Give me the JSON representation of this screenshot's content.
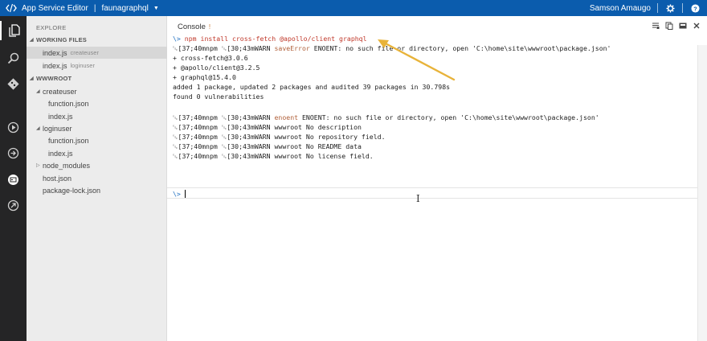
{
  "topbar": {
    "app_title": "App Service Editor",
    "separator": "|",
    "site_name": "faunagraphql",
    "user_name": "Samson Amaugo",
    "accent_color": "#0b5cad",
    "icons": [
      "app-logo-icon",
      "caret-down-icon",
      "gear-icon",
      "help-icon"
    ]
  },
  "rail": {
    "items": [
      "files-icon",
      "search-icon",
      "git-icon",
      "run-icon",
      "output-icon",
      "console-icon",
      "open-site-icon"
    ],
    "active": "files-icon"
  },
  "sidebar": {
    "header": "EXPLORE",
    "working_files_label": "WORKING FILES",
    "working_files": [
      {
        "name": "index.js",
        "folder": "createuser"
      },
      {
        "name": "index.js",
        "folder": "loginuser"
      }
    ],
    "root_label": "WWWROOT",
    "tree": {
      "createuser": "createuser",
      "createuser_function": "function.json",
      "createuser_index": "index.js",
      "loginuser": "loginuser",
      "loginuser_function": "function.json",
      "loginuser_index": "index.js",
      "node_modules": "node_modules",
      "host": "host.json",
      "package_lock": "package-lock.json"
    }
  },
  "main": {
    "tab_label": "Console",
    "tab_badge": "!",
    "toolbar_icons": [
      "clear-console-icon",
      "copy-icon",
      "layout-icon",
      "close-icon"
    ],
    "console": {
      "prompt": "\\>",
      "command": "npm install cross-fetch @apollo/client graphql",
      "lines": [
        {
          "prefix": "␛[37;40mnpm ␛[30;43mWARN ",
          "level": "saveError",
          "text": " ENOENT: no such file or directory, open 'C:\\home\\site\\wwwroot\\package.json'"
        },
        {
          "prefix": "",
          "level": "",
          "text": "+ cross-fetch@3.0.6"
        },
        {
          "prefix": "",
          "level": "",
          "text": "+ @apollo/client@3.2.5"
        },
        {
          "prefix": "",
          "level": "",
          "text": "+ graphql@15.4.0"
        },
        {
          "prefix": "",
          "level": "",
          "text": "added 1 package, updated 2 packages and audited 39 packages in 30.798s"
        },
        {
          "prefix": "",
          "level": "",
          "text": "found 0 vulnerabilities"
        },
        {
          "prefix": "",
          "level": "",
          "text": ""
        },
        {
          "prefix": "␛[37;40mnpm ␛[30;43mWARN ",
          "level": "enoent",
          "text": " ENOENT: no such file or directory, open 'C:\\home\\site\\wwwroot\\package.json'"
        },
        {
          "prefix": "␛[37;40mnpm ␛[30;43mWARN ",
          "level": "",
          "text": "wwwroot No description"
        },
        {
          "prefix": "␛[37;40mnpm ␛[30;43mWARN ",
          "level": "",
          "text": "wwwroot No repository field."
        },
        {
          "prefix": "␛[37;40mnpm ␛[30;43mWARN ",
          "level": "",
          "text": "wwwroot No README data"
        },
        {
          "prefix": "␛[37;40mnpm ␛[30;43mWARN ",
          "level": "",
          "text": "wwwroot No license field."
        }
      ],
      "input_prompt": "\\>",
      "input_value": ""
    }
  },
  "annotation": {
    "arrow_color": "#e8b33a"
  }
}
